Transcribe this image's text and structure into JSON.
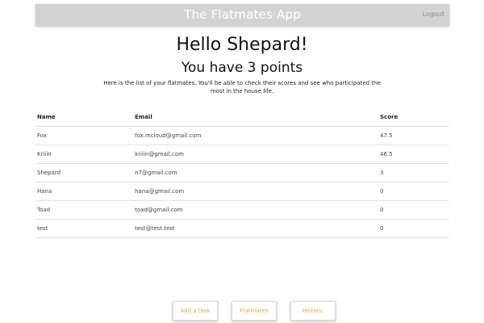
{
  "header": {
    "title": "The Flatmates App",
    "logout_label": "Logout"
  },
  "greeting": "Hello Shepard!",
  "points_text": "You have 3 points",
  "intro": "Here is the list of your flatmates. You'll be able to check their scores and see who participated the most in the house life.",
  "table": {
    "headers": [
      "Name",
      "Email",
      "Score"
    ],
    "rows": [
      {
        "name": "Fox",
        "email": "fox.mcloud@gmail.com",
        "score": "47.5"
      },
      {
        "name": "Kriiin",
        "email": "kriiin@gmail.com",
        "score": "46.5"
      },
      {
        "name": "Shepard",
        "email": "n7@gmail.com",
        "score": "3"
      },
      {
        "name": "Hana",
        "email": "hana@gmail.com",
        "score": "0"
      },
      {
        "name": "Toad",
        "email": "toad@gmail.com",
        "score": "0"
      },
      {
        "name": "test",
        "email": "test@test.test",
        "score": "0"
      }
    ]
  },
  "nav": {
    "add_task_label": "Add a task",
    "flatmates_label": "Flatmates",
    "historic_label": "Historic"
  },
  "colors": {
    "header_bg": "#d3d3d3",
    "accent": "#e8a04a"
  }
}
